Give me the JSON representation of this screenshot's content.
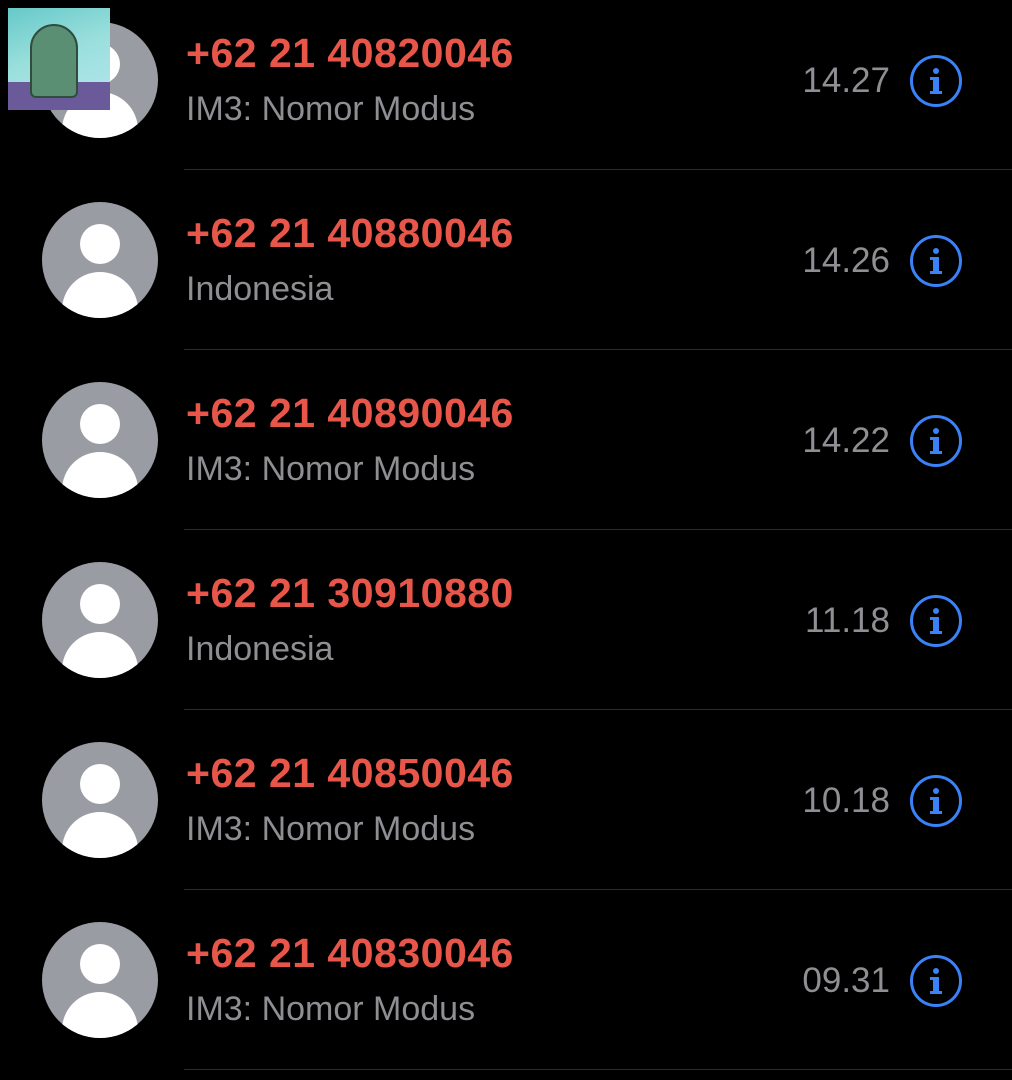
{
  "calls": [
    {
      "number": "+62 21 40820046",
      "subtitle": "IM3: Nomor Modus",
      "time": "14.27"
    },
    {
      "number": "+62 21 40880046",
      "subtitle": "Indonesia",
      "time": "14.26"
    },
    {
      "number": "+62 21 40890046",
      "subtitle": "IM3: Nomor Modus",
      "time": "14.22"
    },
    {
      "number": "+62 21 30910880",
      "subtitle": "Indonesia",
      "time": "11.18"
    },
    {
      "number": "+62 21 40850046",
      "subtitle": "IM3: Nomor Modus",
      "time": "10.18"
    },
    {
      "number": "+62 21 40830046",
      "subtitle": "IM3: Nomor Modus",
      "time": "09.31"
    }
  ],
  "colors": {
    "missed_call_red": "#e8564a",
    "secondary_gray": "#8e8e93",
    "info_blue": "#3a82f7",
    "background": "#000000",
    "avatar_gray": "#9a9ca3"
  },
  "icons": {
    "info": "info-circle-icon",
    "avatar": "person-silhouette-icon"
  }
}
